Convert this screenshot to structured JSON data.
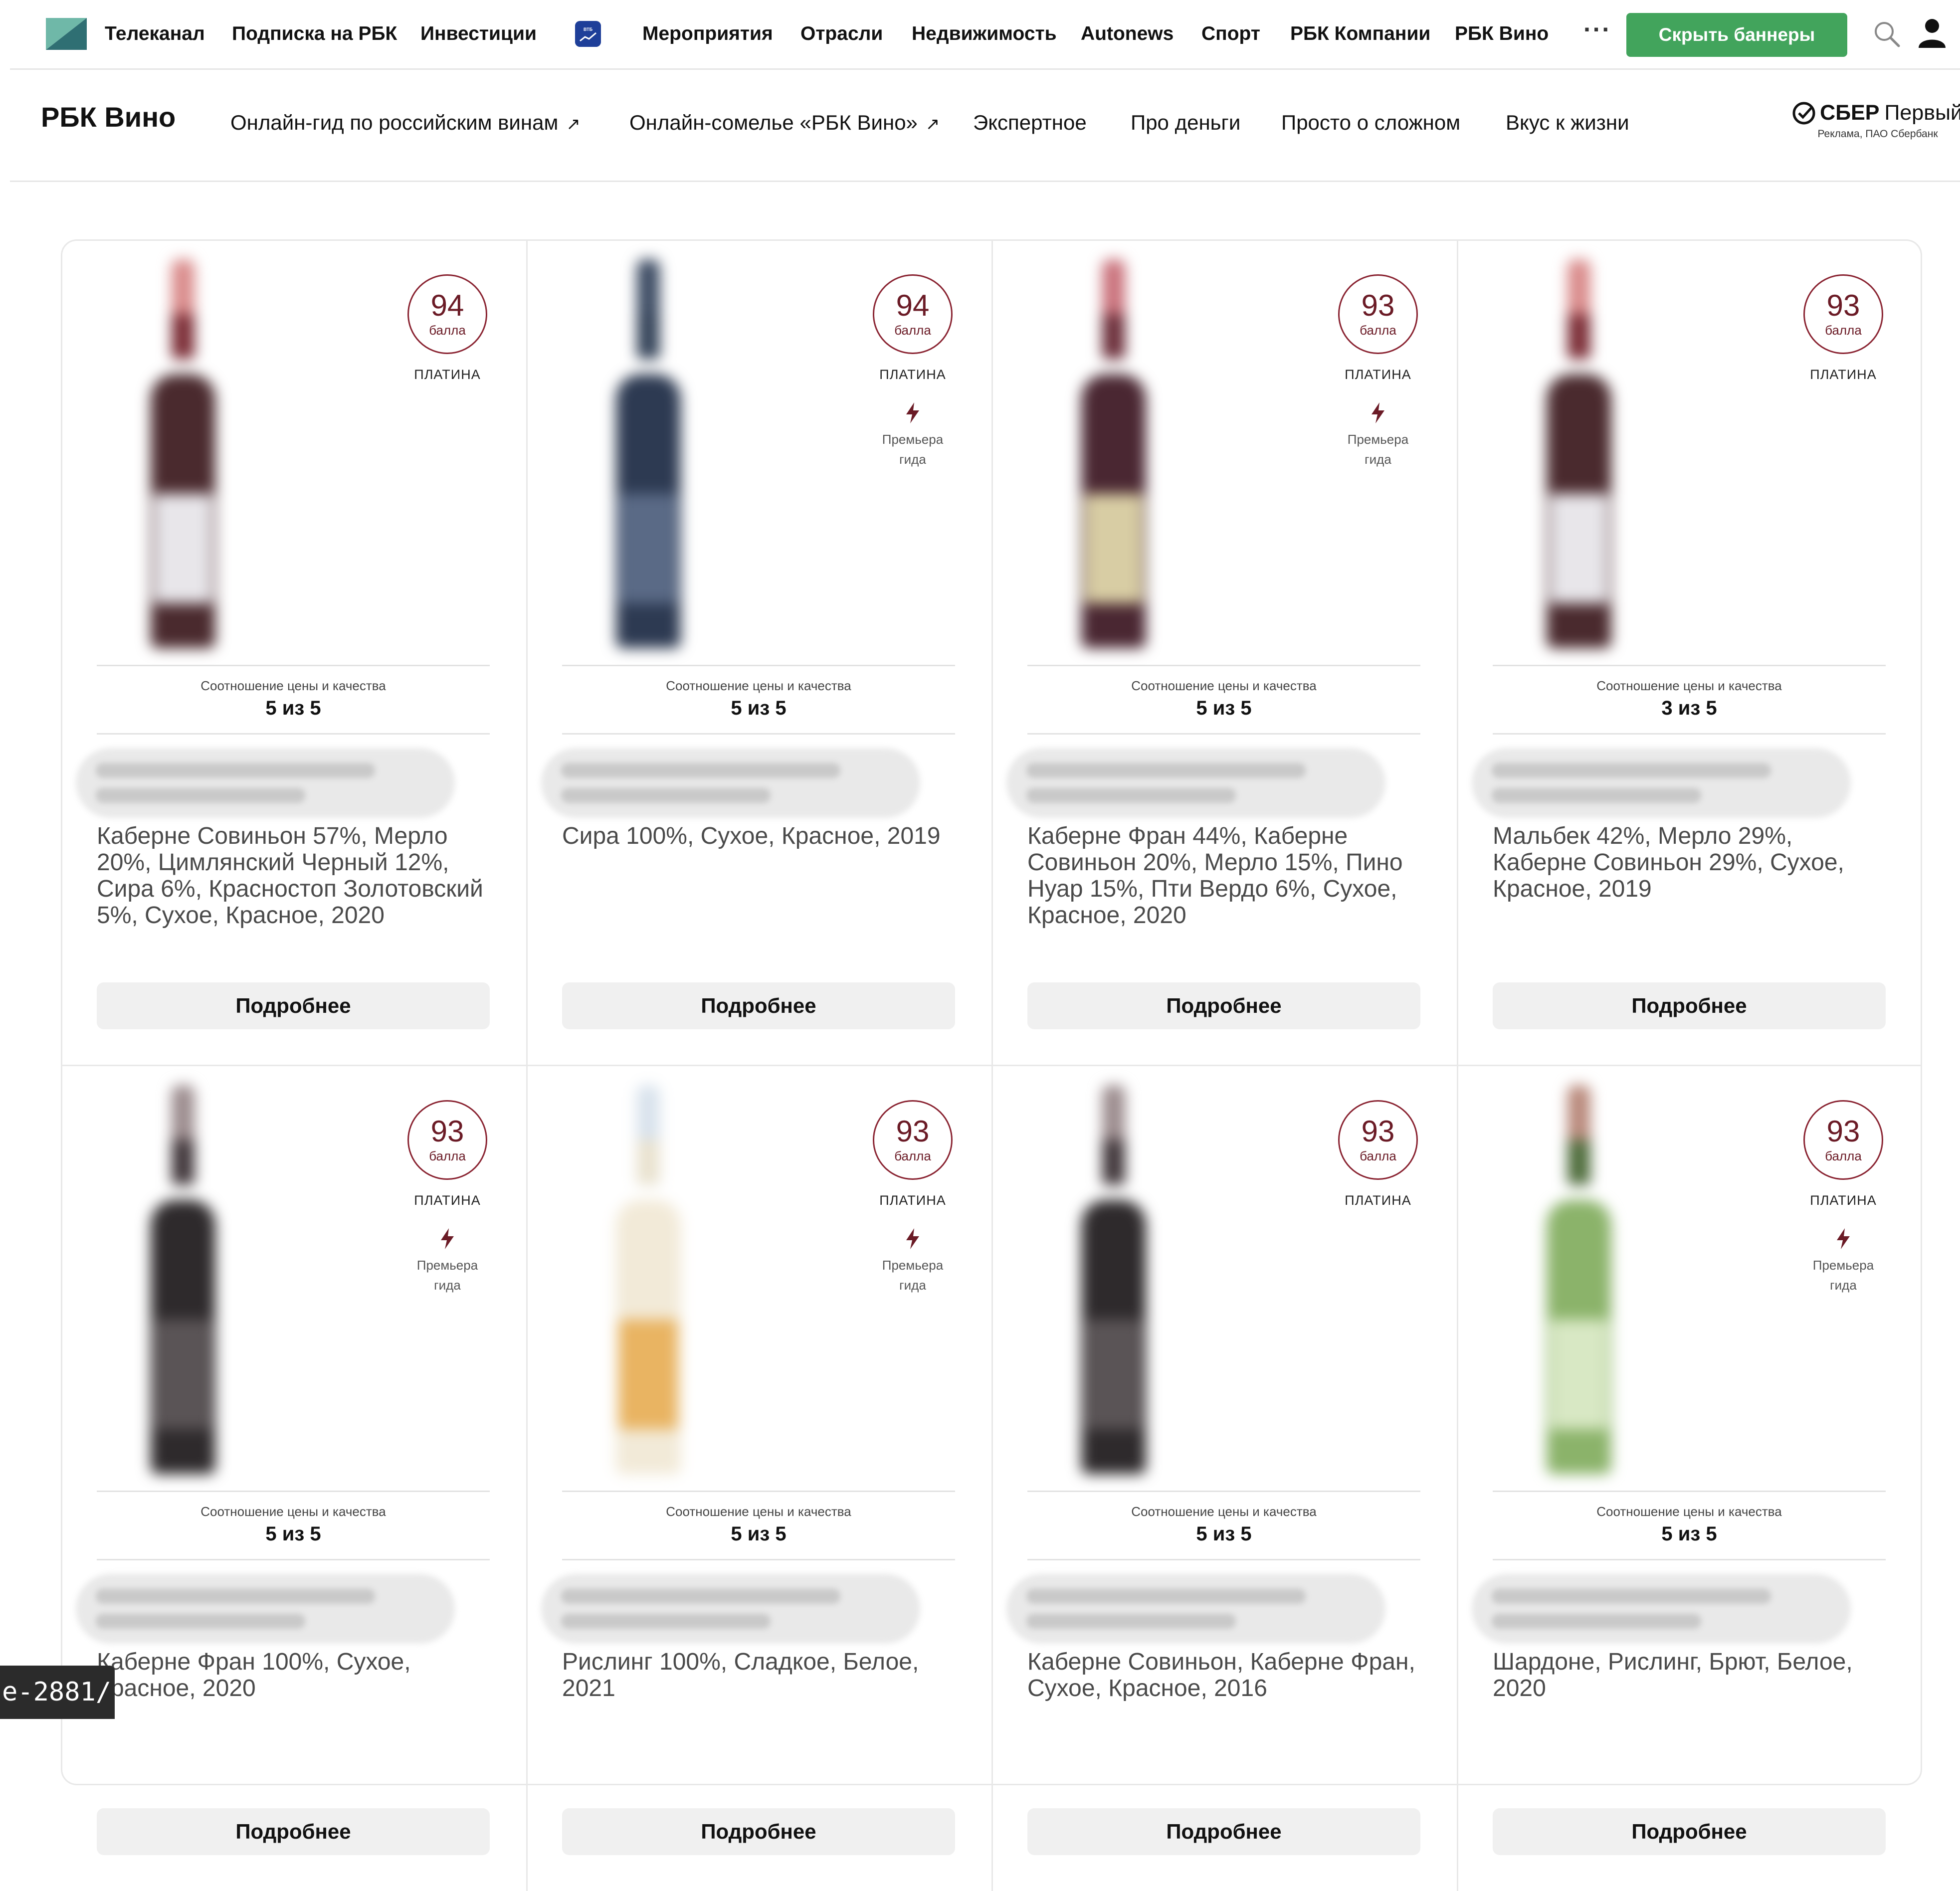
{
  "topnav": {
    "items": [
      "Телеканал",
      "Подписка на РБК",
      "Инвестиции",
      "Мероприятия",
      "Отрасли",
      "Недвижимость",
      "Autonews",
      "Спорт",
      "РБК Компании",
      "РБК Вино"
    ],
    "more_label": "···",
    "hide_banners_label": "Скрыть баннеры"
  },
  "subnav": {
    "brand": "РБК Вино",
    "items": [
      "Онлайн-гид по российским винам",
      "Онлайн-сомелье «РБК Вино»",
      "Экспертное",
      "Про деньги",
      "Просто о сложном",
      "Вкус к жизни"
    ],
    "external_arrow": "↗",
    "sponsor_name": "СБЕР",
    "sponsor_suffix": "Первый",
    "sponsor_note": "Реклама, ПАО Сбербанк"
  },
  "common": {
    "score_unit": "балла",
    "ratio_label": "Соотношение цены и качества",
    "more_button": "Подробнее",
    "premiere_label": "Премьера гида"
  },
  "cards": [
    {
      "score": "94",
      "tier": "ПЛАТИНА",
      "premiere": false,
      "ratio": "5 из 5",
      "desc": "Каберне Совиньон 57%, Мерло 20%, Цимлянский Черный 12%, Сира 6%, Красностоп Золотовский 5%, Сухое, Красное, 2020",
      "bottle": "red"
    },
    {
      "score": "94",
      "tier": "ПЛАТИНА",
      "premiere": true,
      "ratio": "5 из 5",
      "desc": "Сира 100%, Сухое, Красное, 2019",
      "bottle": "darkblue"
    },
    {
      "score": "93",
      "tier": "ПЛАТИНА",
      "premiere": true,
      "ratio": "5 из 5",
      "desc": "Каберне Фран 44%, Каберне Совиньон 20%, Мерло 15%, Пино Нуар 15%, Пти Вердо 6%, Сухое, Красное, 2020",
      "bottle": "burgundy"
    },
    {
      "score": "93",
      "tier": "ПЛАТИНА",
      "premiere": false,
      "ratio": "3 из 5",
      "desc": "Мальбек 42%, Мерло 29%, Каберне Совиньон 29%, Сухое, Красное, 2019",
      "bottle": "red"
    },
    {
      "score": "93",
      "tier": "ПЛАТИНА",
      "premiere": true,
      "ratio": "5 из 5",
      "desc": "Каберне Фран 100%, Сухое, Красное, 2020",
      "bottle": "dark"
    },
    {
      "score": "93",
      "tier": "ПЛАТИНА",
      "premiere": true,
      "ratio": "5 из 5",
      "desc": "Рислинг 100%, Сладкое, Белое, 2021",
      "bottle": "white"
    },
    {
      "score": "93",
      "tier": "ПЛАТИНА",
      "premiere": false,
      "ratio": "5 из 5",
      "desc": "Каберне Совиньон, Каберне Фран, Сухое, Красное, 2016",
      "bottle": "dark"
    },
    {
      "score": "93",
      "tier": "ПЛАТИНА",
      "premiere": true,
      "ratio": "5 из 5",
      "desc": "Шардоне, Рислинг, Брют, Белое, 2020",
      "bottle": "green"
    }
  ],
  "status_url": "e-2881/",
  "colors": {
    "accent_green": "#42a45c",
    "score_burgundy": "#8a2432",
    "button_gray": "#f0f0f0"
  }
}
